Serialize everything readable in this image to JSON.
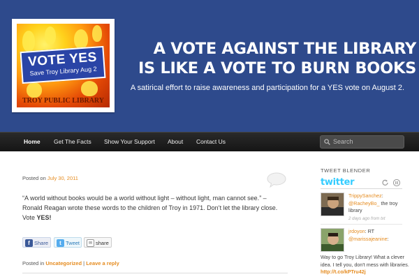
{
  "header": {
    "logo": {
      "sign_title": "VOTE YES",
      "sign_subtitle": "Save Troy Library Aug 2",
      "caption": "TROY PUBLIC LIBRARY"
    },
    "title_line1": "A VOTE AGAINST THE LIBRARY",
    "title_line2": "IS LIKE A VOTE TO BURN BOOKS",
    "description": "A satirical effort to raise awareness and participation for a YES vote on August 2."
  },
  "nav": {
    "items": [
      {
        "label": "Home"
      },
      {
        "label": "Get The Facts"
      },
      {
        "label": "Show Your Support"
      },
      {
        "label": "About"
      },
      {
        "label": "Contact Us"
      }
    ],
    "search_placeholder": "Search"
  },
  "post": {
    "posted_on": "Posted on",
    "date": "July 30, 2011",
    "body": "“A world without books would be a world without light – without light, man cannot see.” – Ronald Reagan wrote these words to the children of Troy in 1971. Don’t let the library close. Vote",
    "body_emphasis": "YES!",
    "share": {
      "facebook": "Share",
      "twitter": "Tweet",
      "email": "share"
    },
    "footer_posted_in": "Posted in",
    "category": "Uncategorized",
    "separator": "|",
    "leave_reply": "Leave a reply"
  },
  "sidebar": {
    "widget_title": "TWEET BLENDER",
    "twitter_logo": "twitter",
    "tweets": [
      {
        "user": "TrippySanchez",
        "mention": "@RacheyBo_",
        "text": "the troy library",
        "meta": "2 days ago from txt"
      },
      {
        "user": "jrdoyon",
        "prefix": "RT",
        "mention": "@marissajeanine",
        "text_a": "Way to go Troy Library! What a clever idea. I tell you, don't mess with libraries.",
        "link": "http://t.co/kPTru42j"
      }
    ]
  },
  "colors": {
    "header_blue": "#2e4a8c",
    "accent_orange": "#e58b1f",
    "twitter_blue": "#33ccff",
    "nav_dark": "#1d1d1d"
  }
}
